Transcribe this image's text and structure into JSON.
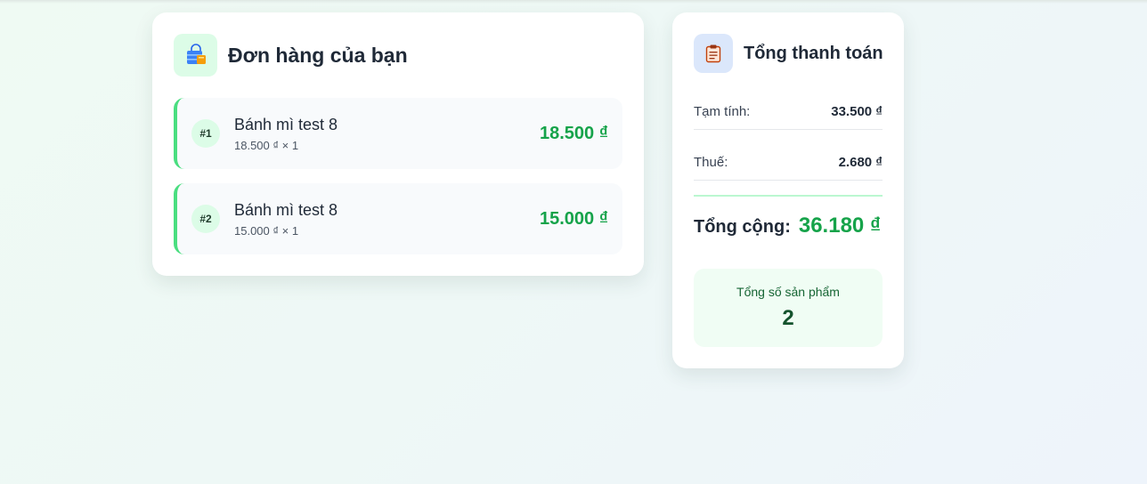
{
  "orders": {
    "title": "Đơn hàng của bạn",
    "icon": "shopping-bag-icon",
    "items": [
      {
        "index": "#1",
        "name": "Bánh mì test 8",
        "detail": "18.500 ₫ × 1",
        "price": "18.500 ₫"
      },
      {
        "index": "#2",
        "name": "Bánh mì test 8",
        "detail": "15.000 ₫ × 1",
        "price": "15.000 ₫"
      }
    ]
  },
  "summary": {
    "title": "Tổng thanh toán",
    "icon": "clipboard-icon",
    "subtotal_label": "Tạm tính:",
    "subtotal_value": "33.500 ₫",
    "tax_label": "Thuế:",
    "tax_value": "2.680 ₫",
    "total_label": "Tổng cộng:",
    "total_value": "36.180 ₫",
    "count_label": "Tổng số sản phẩm",
    "count_value": "2"
  },
  "colors": {
    "accent_green": "#16a34a",
    "item_border": "#4ade80",
    "badge_bg": "#dcfce7",
    "summary_icon_bg": "#dbe7fb"
  }
}
